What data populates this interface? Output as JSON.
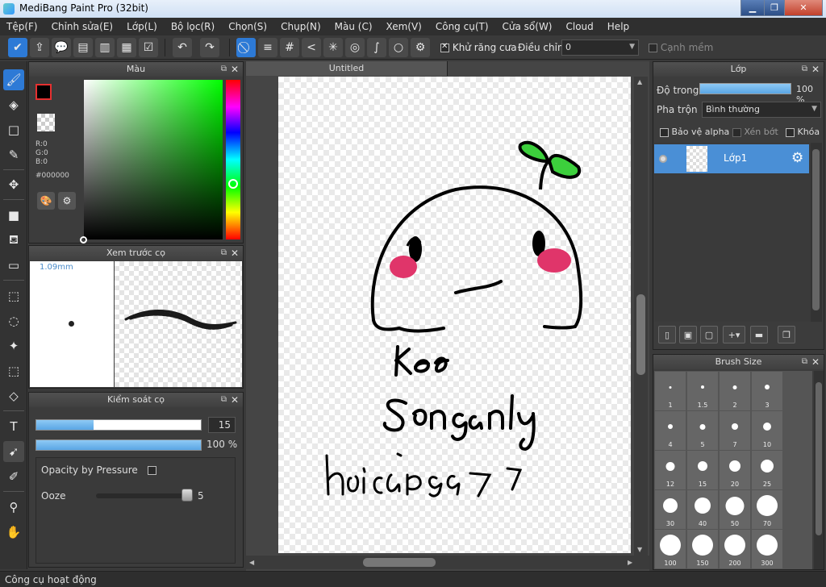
{
  "window": {
    "title": "MediBang Paint Pro (32bit)"
  },
  "menu": [
    "Tệp(F)",
    "Chỉnh sửa(E)",
    "Lớp(L)",
    "Bộ lọc(R)",
    "Chọn(S)",
    "Chụp(N)",
    "Màu (C)",
    "Xem(V)",
    "Công cụ(T)",
    "Cửa sổ(W)",
    "Cloud",
    "Help"
  ],
  "toolbar": {
    "antialias_label": "Khử răng cưa",
    "antialias_checked": true,
    "adjust_label": "Điều chỉnh",
    "adjust_value": "0",
    "soft_edge_label": "Cạnh mềm"
  },
  "color_panel": {
    "title": "Màu",
    "r": "R:0",
    "g": "G:0",
    "b": "B:0",
    "hex": "#000000",
    "foreground": "#000000",
    "accent_border": "#e53030"
  },
  "brush_preview": {
    "title": "Xem trước cọ",
    "size_label": "1.09mm"
  },
  "brush_control": {
    "title": "Kiểm soát cọ",
    "size_value": "15",
    "opacity_value": "100 %",
    "size_fraction": 0.35,
    "opacity_fraction": 1.0,
    "opacity_by_pressure_label": "Opacity by Pressure",
    "ooze_label": "Ooze",
    "ooze_value": "5",
    "ooze_fraction": 0.9
  },
  "document": {
    "tab_title": "Untitled"
  },
  "layer_panel": {
    "title": "Lớp",
    "opacity_label": "Độ trong",
    "opacity_value": "100 %",
    "blend_label": "Pha trộn",
    "blend_value": "Bình thường",
    "protect_alpha_label": "Bảo vệ alpha",
    "clipping_label": "Xén bớt",
    "lock_label": "Khóa",
    "layers": [
      {
        "name": "Lớp1",
        "selected": true
      }
    ]
  },
  "brush_size_panel": {
    "title": "Brush Size",
    "sizes": [
      "1",
      "1.5",
      "2",
      "3",
      "4",
      "5",
      "7",
      "10",
      "12",
      "15",
      "20",
      "25",
      "30",
      "40",
      "50",
      "70",
      "100",
      "150",
      "200",
      "300"
    ]
  },
  "status": {
    "text": "Công cụ hoạt động"
  },
  "accent_color": "#2d7ad6"
}
